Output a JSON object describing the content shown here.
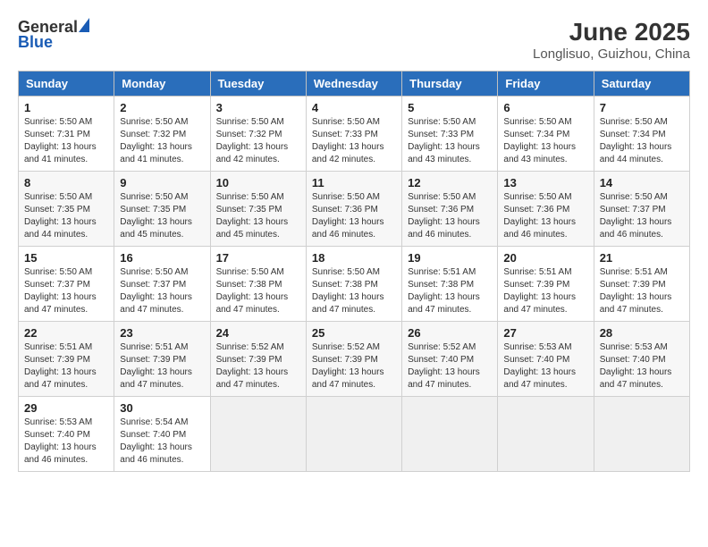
{
  "logo": {
    "general": "General",
    "blue": "Blue"
  },
  "title": "June 2025",
  "subtitle": "Longlisuo, Guizhou, China",
  "weekdays": [
    "Sunday",
    "Monday",
    "Tuesday",
    "Wednesday",
    "Thursday",
    "Friday",
    "Saturday"
  ],
  "weeks": [
    [
      {
        "day": "1",
        "info": "Sunrise: 5:50 AM\nSunset: 7:31 PM\nDaylight: 13 hours\nand 41 minutes."
      },
      {
        "day": "2",
        "info": "Sunrise: 5:50 AM\nSunset: 7:32 PM\nDaylight: 13 hours\nand 41 minutes."
      },
      {
        "day": "3",
        "info": "Sunrise: 5:50 AM\nSunset: 7:32 PM\nDaylight: 13 hours\nand 42 minutes."
      },
      {
        "day": "4",
        "info": "Sunrise: 5:50 AM\nSunset: 7:33 PM\nDaylight: 13 hours\nand 42 minutes."
      },
      {
        "day": "5",
        "info": "Sunrise: 5:50 AM\nSunset: 7:33 PM\nDaylight: 13 hours\nand 43 minutes."
      },
      {
        "day": "6",
        "info": "Sunrise: 5:50 AM\nSunset: 7:34 PM\nDaylight: 13 hours\nand 43 minutes."
      },
      {
        "day": "7",
        "info": "Sunrise: 5:50 AM\nSunset: 7:34 PM\nDaylight: 13 hours\nand 44 minutes."
      }
    ],
    [
      {
        "day": "8",
        "info": "Sunrise: 5:50 AM\nSunset: 7:35 PM\nDaylight: 13 hours\nand 44 minutes."
      },
      {
        "day": "9",
        "info": "Sunrise: 5:50 AM\nSunset: 7:35 PM\nDaylight: 13 hours\nand 45 minutes."
      },
      {
        "day": "10",
        "info": "Sunrise: 5:50 AM\nSunset: 7:35 PM\nDaylight: 13 hours\nand 45 minutes."
      },
      {
        "day": "11",
        "info": "Sunrise: 5:50 AM\nSunset: 7:36 PM\nDaylight: 13 hours\nand 46 minutes."
      },
      {
        "day": "12",
        "info": "Sunrise: 5:50 AM\nSunset: 7:36 PM\nDaylight: 13 hours\nand 46 minutes."
      },
      {
        "day": "13",
        "info": "Sunrise: 5:50 AM\nSunset: 7:36 PM\nDaylight: 13 hours\nand 46 minutes."
      },
      {
        "day": "14",
        "info": "Sunrise: 5:50 AM\nSunset: 7:37 PM\nDaylight: 13 hours\nand 46 minutes."
      }
    ],
    [
      {
        "day": "15",
        "info": "Sunrise: 5:50 AM\nSunset: 7:37 PM\nDaylight: 13 hours\nand 47 minutes."
      },
      {
        "day": "16",
        "info": "Sunrise: 5:50 AM\nSunset: 7:37 PM\nDaylight: 13 hours\nand 47 minutes."
      },
      {
        "day": "17",
        "info": "Sunrise: 5:50 AM\nSunset: 7:38 PM\nDaylight: 13 hours\nand 47 minutes."
      },
      {
        "day": "18",
        "info": "Sunrise: 5:50 AM\nSunset: 7:38 PM\nDaylight: 13 hours\nand 47 minutes."
      },
      {
        "day": "19",
        "info": "Sunrise: 5:51 AM\nSunset: 7:38 PM\nDaylight: 13 hours\nand 47 minutes."
      },
      {
        "day": "20",
        "info": "Sunrise: 5:51 AM\nSunset: 7:39 PM\nDaylight: 13 hours\nand 47 minutes."
      },
      {
        "day": "21",
        "info": "Sunrise: 5:51 AM\nSunset: 7:39 PM\nDaylight: 13 hours\nand 47 minutes."
      }
    ],
    [
      {
        "day": "22",
        "info": "Sunrise: 5:51 AM\nSunset: 7:39 PM\nDaylight: 13 hours\nand 47 minutes."
      },
      {
        "day": "23",
        "info": "Sunrise: 5:51 AM\nSunset: 7:39 PM\nDaylight: 13 hours\nand 47 minutes."
      },
      {
        "day": "24",
        "info": "Sunrise: 5:52 AM\nSunset: 7:39 PM\nDaylight: 13 hours\nand 47 minutes."
      },
      {
        "day": "25",
        "info": "Sunrise: 5:52 AM\nSunset: 7:39 PM\nDaylight: 13 hours\nand 47 minutes."
      },
      {
        "day": "26",
        "info": "Sunrise: 5:52 AM\nSunset: 7:40 PM\nDaylight: 13 hours\nand 47 minutes."
      },
      {
        "day": "27",
        "info": "Sunrise: 5:53 AM\nSunset: 7:40 PM\nDaylight: 13 hours\nand 47 minutes."
      },
      {
        "day": "28",
        "info": "Sunrise: 5:53 AM\nSunset: 7:40 PM\nDaylight: 13 hours\nand 47 minutes."
      }
    ],
    [
      {
        "day": "29",
        "info": "Sunrise: 5:53 AM\nSunset: 7:40 PM\nDaylight: 13 hours\nand 46 minutes."
      },
      {
        "day": "30",
        "info": "Sunrise: 5:54 AM\nSunset: 7:40 PM\nDaylight: 13 hours\nand 46 minutes."
      },
      {
        "day": "",
        "info": ""
      },
      {
        "day": "",
        "info": ""
      },
      {
        "day": "",
        "info": ""
      },
      {
        "day": "",
        "info": ""
      },
      {
        "day": "",
        "info": ""
      }
    ]
  ]
}
